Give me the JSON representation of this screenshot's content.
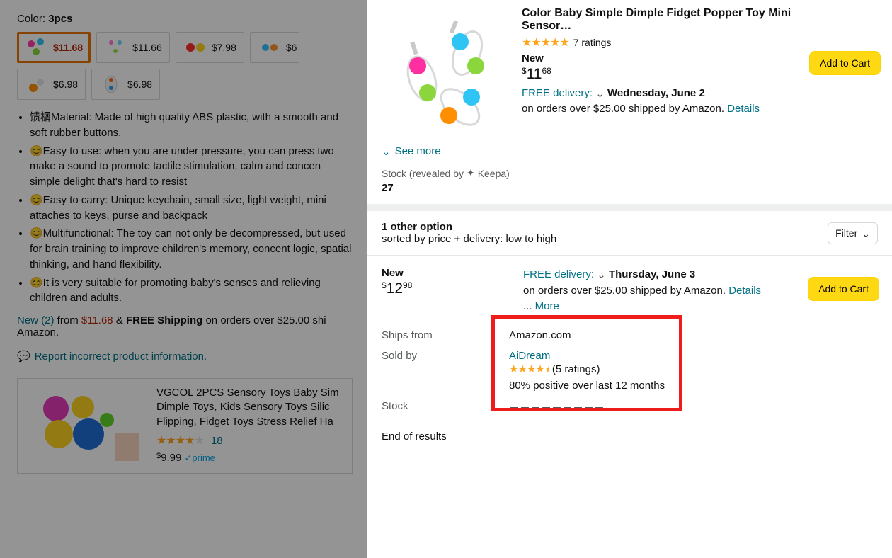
{
  "left": {
    "color_label": "Color:",
    "color_value": "3pcs",
    "variants": [
      {
        "price": "$11.68",
        "selected": true
      },
      {
        "price": "$11.66"
      },
      {
        "price": "$7.98"
      },
      {
        "price": "$6"
      },
      {
        "price": "$6.98"
      },
      {
        "price": "$6.98"
      }
    ],
    "bullets": [
      "馈榍Material: Made of high quality ABS plastic, with a smooth and soft rubber buttons.",
      "😊Easy to use: when you are under pressure, you can press two make a sound to promote tactile stimulation, calm and concen simple delight that's hard to resist",
      "😊Easy to carry: Unique keychain, small size, light weight, mini attaches to keys, purse and backpack",
      "😊Multifunctional: The toy can not only be decompressed, but used for brain training to improve children's memory, concent logic, spatial thinking, and hand flexibility.",
      "😊It is very suitable for promoting baby's senses and relieving children and adults."
    ],
    "new_from_prefix": "New (2)",
    "new_from_mid": " from ",
    "new_from_price": "$11.68",
    "new_from_amp": " & ",
    "new_from_ship": "FREE Shipping",
    "new_from_tail": " on orders over $25.00 shi Amazon.",
    "report": "Report incorrect product information.",
    "related_title": "VGCOL 2PCS Sensory Toys Baby Sim Dimple Toys, Kids Sensory Toys Silic Flipping, Fidget Toys Stress Relief Ha",
    "related_rating_count": "18",
    "related_price": "9.99",
    "related_prime": "prime"
  },
  "right": {
    "title": "Color Baby Simple Dimple Fidget Popper Toy Mini Sensor…",
    "rating_count": "7 ratings",
    "condition": "New",
    "price_whole": "11",
    "price_frac": "68",
    "delivery_free": "FREE delivery:",
    "delivery_date": "Wednesday, June 2",
    "delivery_tail": "on orders over $25.00 shipped by Amazon. ",
    "details": "Details",
    "add_to_cart": "Add to Cart",
    "see_more": "See more",
    "stock_label": "Stock (revealed by ",
    "keepa": "Keepa)",
    "stock_value": "27",
    "other_opt": "1 other option",
    "sort_line": "sorted by price + delivery: low to high",
    "filter": "Filter",
    "offer2": {
      "condition": "New",
      "price_whole": "12",
      "price_frac": "98",
      "delivery_free": "FREE delivery:",
      "delivery_date": "Thursday, June 3",
      "delivery_tail": "on orders over $25.00 shipped by Amazon. ",
      "details": "Details",
      "more": "More",
      "ships_from_k": "Ships from",
      "ships_from_v": "Amazon.com",
      "sold_by_k": "Sold by",
      "seller": "AiDream",
      "seller_rcount": "(5 ratings)",
      "seller_pos": "80% positive over last 12 months",
      "stock_k": "Stock"
    },
    "end": "End of results"
  }
}
